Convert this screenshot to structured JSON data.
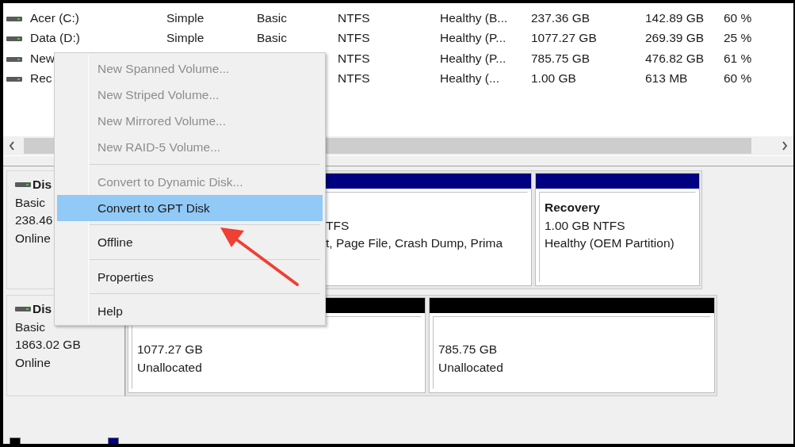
{
  "volumes": [
    {
      "name": "Acer (C:)",
      "layout": "Simple",
      "type": "Basic",
      "file_system": "NTFS",
      "status": "Healthy (B...",
      "capacity": "237.36 GB",
      "free_space": "142.89 GB",
      "percent_free": "60 %"
    },
    {
      "name": "Data (D:)",
      "layout": "Simple",
      "type": "Basic",
      "file_system": "NTFS",
      "status": "Healthy (P...",
      "capacity": "1077.27 GB",
      "free_space": "269.39 GB",
      "percent_free": "25 %"
    },
    {
      "name": "New",
      "file_system": "NTFS",
      "status": "Healthy (P...",
      "capacity": "785.75 GB",
      "free_space": "476.82 GB",
      "percent_free": "61 %"
    },
    {
      "name": "Rec",
      "file_system": "NTFS",
      "status": "Healthy (...",
      "capacity": "1.00 GB",
      "free_space": "613 MB",
      "percent_free": "60 %"
    }
  ],
  "disks": [
    {
      "label": "Dis",
      "lines": [
        "Basic",
        "238.46",
        "Online"
      ],
      "partitions": [
        {
          "kind": "primary",
          "lines": [
            "TFS",
            "t, Page File, Crash Dump, Prima"
          ]
        },
        {
          "kind": "primary",
          "name": "Recovery",
          "lines": [
            "1.00 GB NTFS",
            "Healthy (OEM Partition)"
          ]
        }
      ]
    },
    {
      "label": "Dis",
      "lines": [
        "Basic",
        "1863.02 GB",
        "Online"
      ],
      "partitions": [
        {
          "kind": "unallocated",
          "lines": [
            "1077.27 GB",
            "Unallocated"
          ]
        },
        {
          "kind": "unallocated",
          "lines": [
            "785.75 GB",
            "Unallocated"
          ]
        }
      ]
    }
  ],
  "context_menu": {
    "items": [
      {
        "kind": "item",
        "label": "New Spanned Volume...",
        "disabled": true,
        "selected": false
      },
      {
        "kind": "item",
        "label": "New Striped Volume...",
        "disabled": true,
        "selected": false
      },
      {
        "kind": "item",
        "label": "New Mirrored Volume...",
        "disabled": true,
        "selected": false
      },
      {
        "kind": "item",
        "label": "New RAID-5 Volume...",
        "disabled": true,
        "selected": false
      },
      {
        "kind": "separator"
      },
      {
        "kind": "item",
        "label": "Convert to Dynamic Disk...",
        "disabled": true,
        "selected": false
      },
      {
        "kind": "item",
        "label": "Convert to GPT Disk",
        "disabled": false,
        "selected": true
      },
      {
        "kind": "separator"
      },
      {
        "kind": "item",
        "label": "Offline",
        "disabled": false,
        "selected": false
      },
      {
        "kind": "separator"
      },
      {
        "kind": "item",
        "label": "Properties",
        "disabled": false,
        "selected": false
      },
      {
        "kind": "separator"
      },
      {
        "kind": "item",
        "label": "Help",
        "disabled": false,
        "selected": false
      }
    ]
  }
}
